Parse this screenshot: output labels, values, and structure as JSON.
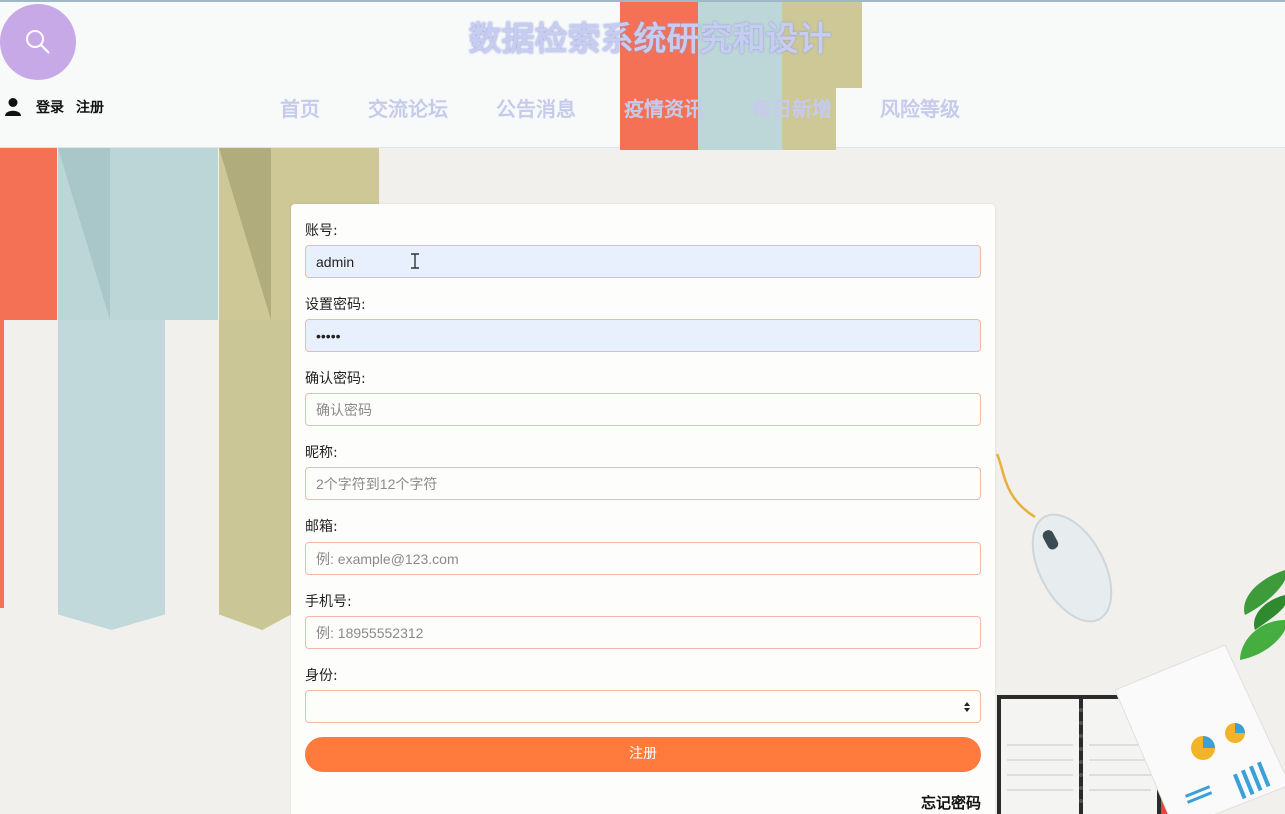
{
  "header": {
    "site_title": "数据检索系统研究和设计",
    "auth": {
      "login": "登录",
      "register": "注册"
    },
    "nav": [
      "首页",
      "交流论坛",
      "公告消息",
      "疫情资讯",
      "每日新增",
      "风险等级"
    ]
  },
  "form": {
    "account": {
      "label": "账号:",
      "value": "admin"
    },
    "password": {
      "label": "设置密码:",
      "value": "admin"
    },
    "confirm": {
      "label": "确认密码:",
      "placeholder": "确认密码"
    },
    "nickname": {
      "label": "昵称:",
      "placeholder": "2个字符到12个字符"
    },
    "email": {
      "label": "邮箱:",
      "placeholder": "例: example@123.com"
    },
    "phone": {
      "label": "手机号:",
      "placeholder": "例: 18955552312"
    },
    "identity": {
      "label": "身份:",
      "value": ""
    },
    "submit_label": "注册",
    "forgot_label": "忘记密码"
  },
  "colors": {
    "accent": "#ff7a3c",
    "input_border": "#f2b7a5",
    "logo_bg": "#c8a9e8",
    "nav_text": "#c7cbeb"
  },
  "icons": {
    "logo": "search-icon",
    "user": "user-icon",
    "select": "select-arrows-icon"
  }
}
